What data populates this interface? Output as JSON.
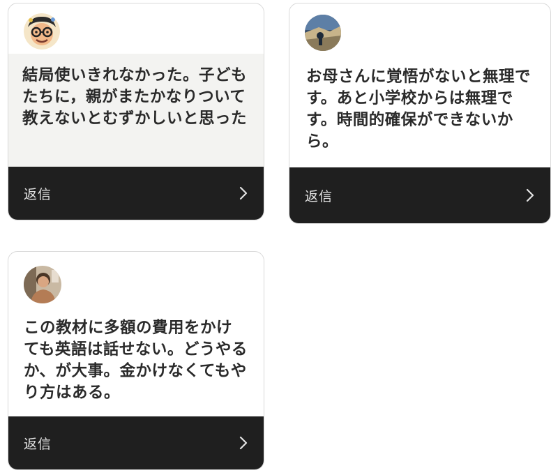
{
  "comments": [
    {
      "avatar_icon": "avatar-cartoon-glasses-man",
      "message": "結局使いきれなかった。子どもたちに，親がまたかなりついて教えないとむずかしいと思った",
      "reply_label": "返信",
      "reply_icon": "chevron-right-icon"
    },
    {
      "avatar_icon": "avatar-photo-landscape",
      "message": "お母さんに覚悟がないと無理です。あと小学校からは無理です。時間的確保ができないから。",
      "reply_label": "返信",
      "reply_icon": "chevron-right-icon"
    },
    {
      "avatar_icon": "avatar-photo-person",
      "message": "この教材に多額の費用をかけても英語は話せない。どうやるか、が大事。金かけなくてもやり方はある。",
      "reply_label": "返信",
      "reply_icon": "chevron-right-icon"
    }
  ],
  "colors": {
    "reply_bar": "#1f1f1f",
    "reply_text": "#e4e4e4",
    "message_text": "#2a2a2a",
    "highlight_bg": "#f3f3f1",
    "card_border": "#d9d9d9"
  }
}
